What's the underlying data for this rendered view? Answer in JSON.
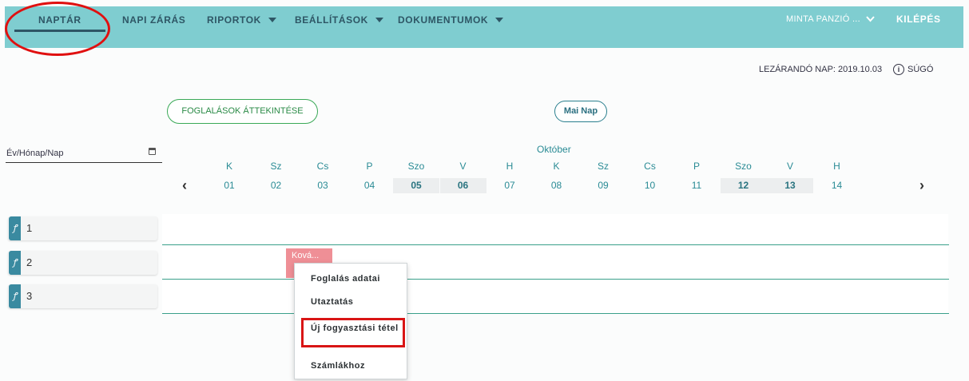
{
  "nav": {
    "items": [
      {
        "label": "NAPTÁR"
      },
      {
        "label": "NAPI ZÁRÁS"
      },
      {
        "label": "RIPORTOK"
      },
      {
        "label": "BEÁLLÍTÁSOK"
      },
      {
        "label": "DOKUMENTUMOK"
      }
    ],
    "user_label": "MINTA PANZIÓ ... ",
    "logout_label": "KILÉPÉS"
  },
  "header": {
    "closing_day_text": "LEZÁRANDÓ NAP: 2019.10.03",
    "help_label": "SÚGÓ"
  },
  "buttons": {
    "overview_label": "FOGLALÁSOK ÁTTEKINTÉSE",
    "today_label": "Mai Nap"
  },
  "date_picker": {
    "placeholder": "Év/Hónap/Nap"
  },
  "calendar": {
    "month": "Október",
    "days": [
      {
        "name": "K",
        "num": "01",
        "weekend": false
      },
      {
        "name": "Sz",
        "num": "02",
        "weekend": false
      },
      {
        "name": "Cs",
        "num": "03",
        "weekend": false
      },
      {
        "name": "P",
        "num": "04",
        "weekend": false
      },
      {
        "name": "Szo",
        "num": "05",
        "weekend": true
      },
      {
        "name": "V",
        "num": "06",
        "weekend": true
      },
      {
        "name": "H",
        "num": "07",
        "weekend": false
      },
      {
        "name": "K",
        "num": "08",
        "weekend": false
      },
      {
        "name": "Sz",
        "num": "09",
        "weekend": false
      },
      {
        "name": "Cs",
        "num": "10",
        "weekend": false
      },
      {
        "name": "P",
        "num": "11",
        "weekend": false
      },
      {
        "name": "Szo",
        "num": "12",
        "weekend": true
      },
      {
        "name": "V",
        "num": "13",
        "weekend": true
      },
      {
        "name": "H",
        "num": "14",
        "weekend": false
      }
    ],
    "prev_icon": "chevron-left-icon",
    "next_icon": "chevron-right-icon"
  },
  "rooms": [
    {
      "label": "1"
    },
    {
      "label": "2"
    },
    {
      "label": "3"
    }
  ],
  "booking": {
    "label": "Ková..."
  },
  "context_menu": {
    "items": [
      {
        "label": "Foglalás adatai"
      },
      {
        "label": "Utaztatás"
      },
      {
        "label": "Új fogyasztási tétel"
      },
      {
        "label": "Számlákhoz"
      }
    ]
  },
  "colors": {
    "topbar": "#7fcdd0",
    "booking": "#ef8f96",
    "accent": "#2a8b95",
    "annotation": "#e01010"
  }
}
